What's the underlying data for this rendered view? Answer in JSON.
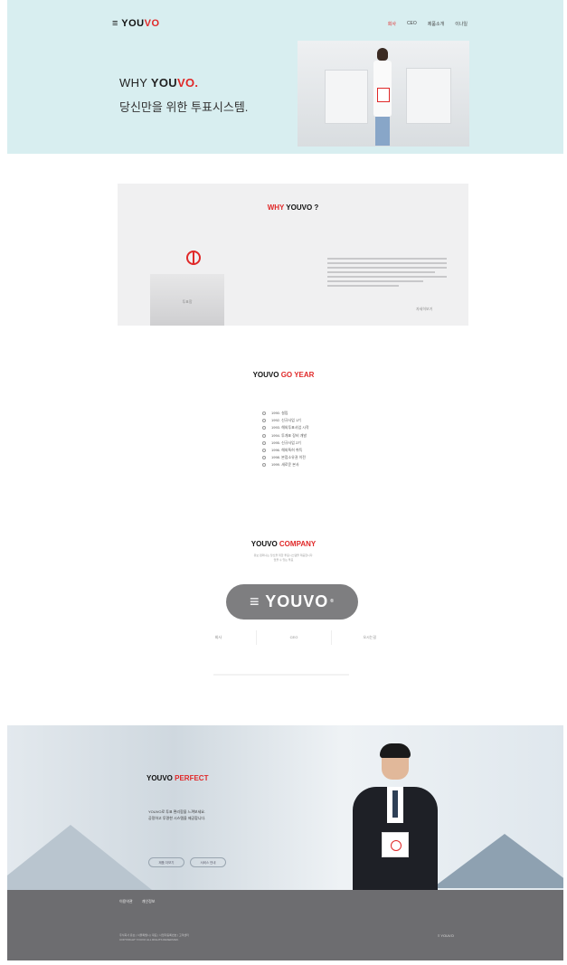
{
  "header": {
    "logo_prefix": "≡",
    "logo_main": "YOU",
    "logo_accent": "VO",
    "nav": [
      "회사",
      "CEO",
      "제품소개",
      "이나일"
    ]
  },
  "hero": {
    "title_prefix": "WHY ",
    "title_bold": "YOU",
    "title_accent": "VO.",
    "subtitle": "당신만을 위한 투표시스템."
  },
  "why": {
    "title_accent": "WHY",
    "title_main": " YOUVO ?",
    "box_label": "투표함",
    "more": "자세히보기"
  },
  "year": {
    "title_main": "YOUVO ",
    "title_accent": "GO YEAR",
    "items": [
      "1990. 설립",
      "1992. 신규사업 1기",
      "1993. 해외투표사업 시작",
      "1994. 투개표 장비 개발",
      "1995. 신규사업 2기",
      "1996. 해외특허 취득",
      "1998. 본점소유권 이전",
      "1999. 새로운 본사"
    ]
  },
  "company": {
    "title_main": "YOUVO ",
    "title_accent": "COMPANY",
    "desc_line1": "유보 컴퍼니는 당신을 위한 투표시스템을 제공합니다.",
    "desc_line2": "믿을 수 있는 투표",
    "pill_icon": "≡",
    "pill_text": "YOUVO",
    "pill_sup": "®",
    "tabs": [
      "회사",
      "CEO",
      "오시는길"
    ]
  },
  "perfect": {
    "title_main": "YOUVO ",
    "title_accent": "PERFECT",
    "desc_line1": "YOUVO로 투표 편리함을 느껴보세요.",
    "desc_line2": "공정하고 투명한 시스템을 제공합니다.",
    "btn1": "제품 더보기",
    "btn2": "서비스 안내"
  },
  "footer": {
    "links": [
      "이용약관",
      "개인정보"
    ],
    "info_line1": "주식회사 유보 | 서울특별시 | 대표 | 사업자등록번호 | 고객센터",
    "info_line2": "COPYRIGHT YOUVO ALL RIGHTS RESERVED.",
    "logo": "≡ YOUVO"
  },
  "colors": {
    "accent": "#e02828",
    "hero_bg": "#d8eef0",
    "footer_bg": "#6d6d70"
  }
}
